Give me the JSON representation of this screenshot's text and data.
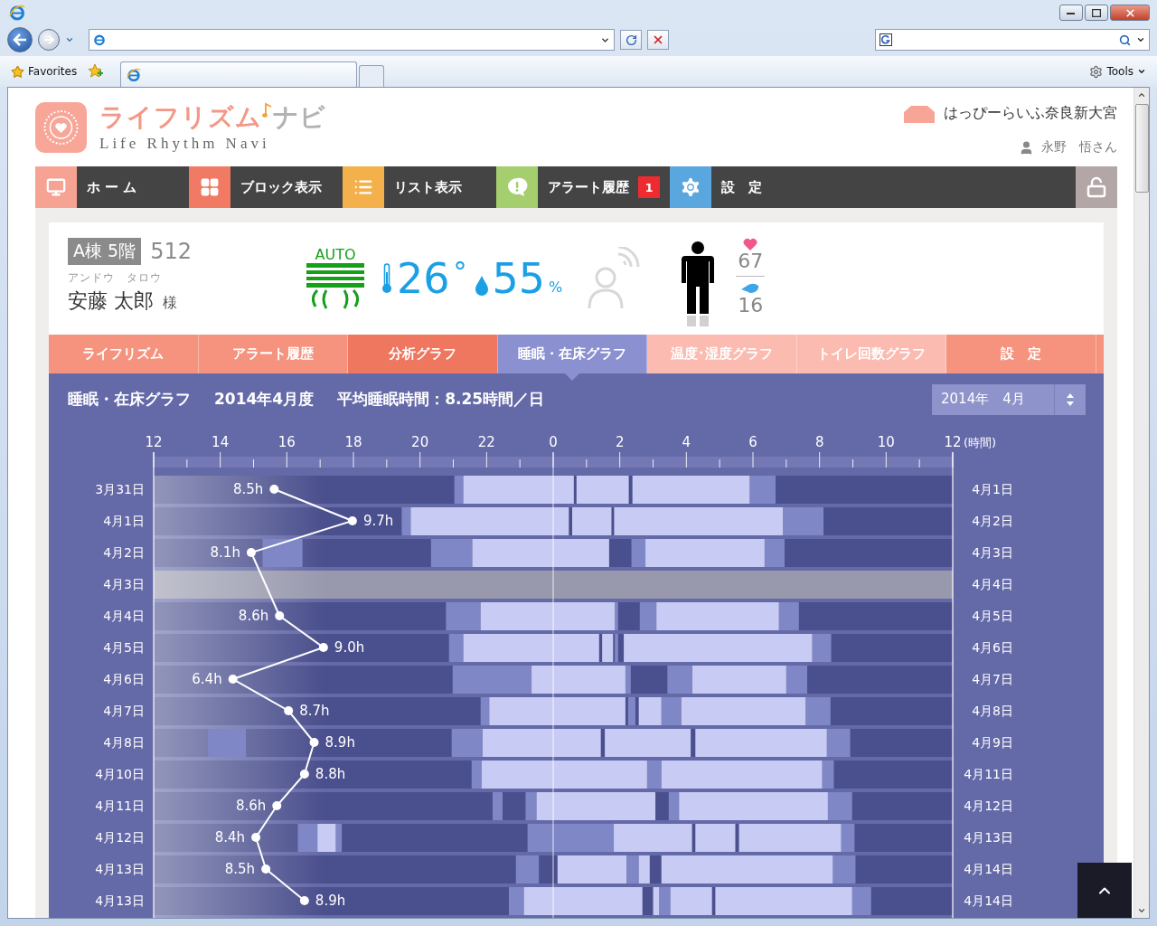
{
  "browser": {
    "favorites": "Favorites",
    "tools": "Tools"
  },
  "header": {
    "logo_main": "ライフリズム",
    "logo_sub": "ナビ",
    "tagline": "Life Rhythm Navi",
    "facility": "はっぴーらいふ奈良新大宮",
    "user": "永野　悟さん"
  },
  "nav": [
    {
      "kind": "home",
      "label": "ホ ー ム",
      "color": "#f7a394"
    },
    {
      "kind": "blocks",
      "label": "ブロック表示",
      "color": "#f07a64"
    },
    {
      "kind": "list",
      "label": "リスト表示",
      "color": "#f4b04a"
    },
    {
      "kind": "alert",
      "label": "アラート履歴",
      "badge": "1",
      "color": "#a5cf6e"
    },
    {
      "kind": "settings",
      "label": "設　定",
      "color": "#5aa7e0"
    }
  ],
  "resident": {
    "building": "A棟 5階",
    "room": "512",
    "kana": "アンドウ　タロウ",
    "name": "安藤 太郎",
    "honorific": "様",
    "aircon_mode": "AUTO",
    "temperature": "26",
    "temperature_unit": "°",
    "humidity": "55",
    "humidity_unit": "%",
    "motion_sensor_active": false,
    "heart_rate": "67",
    "respiration": "16"
  },
  "tabs": [
    {
      "label": "ライフリズム",
      "selected": false,
      "color": "#f5937f"
    },
    {
      "label": "アラート履歴",
      "selected": false,
      "color": "#f5937f"
    },
    {
      "label": "分析グラフ",
      "selected": false,
      "color": "#ef765f"
    },
    {
      "label": "睡眠・在床グラフ",
      "selected": true,
      "color": "#8a90d0"
    },
    {
      "label": "温度･湿度グラフ",
      "selected": false,
      "color": "#fbbbb1"
    },
    {
      "label": "トイレ回数グラフ",
      "selected": false,
      "color": "#fbbbb1"
    },
    {
      "label": "設　定",
      "selected": false,
      "color": "#f5937f"
    }
  ],
  "graph": {
    "title": "睡眠・在床グラフ",
    "period": "2014年4月度",
    "average": "平均睡眠時間：8.25時間／日",
    "month_select": "2014年　4月",
    "axis_labels": [
      "12",
      "14",
      "16",
      "18",
      "20",
      "22",
      "0",
      "2",
      "4",
      "6",
      "8",
      "10",
      "12"
    ],
    "axis_unit": "(時間)",
    "rows": [
      {
        "date": "3月31日",
        "next_date": "4月1日",
        "no_data": false,
        "sleep": "8.5h"
      },
      {
        "date": "4月1日",
        "next_date": "4月2日",
        "no_data": false,
        "sleep": "9.7h"
      },
      {
        "date": "4月2日",
        "next_date": "4月3日",
        "no_data": false,
        "sleep": "8.1h"
      },
      {
        "date": "4月3日",
        "next_date": "4月4日",
        "no_data": true
      },
      {
        "date": "4月4日",
        "next_date": "4月5日",
        "no_data": false,
        "sleep": "8.6h"
      },
      {
        "date": "4月5日",
        "next_date": "4月6日",
        "no_data": false,
        "sleep": "9.0h"
      },
      {
        "date": "4月6日",
        "next_date": "4月7日",
        "no_data": false,
        "sleep": "6.4h"
      },
      {
        "date": "4月7日",
        "next_date": "4月8日",
        "no_data": false,
        "sleep": "8.7h"
      },
      {
        "date": "4月8日",
        "next_date": "4月9日",
        "no_data": false,
        "sleep": "8.9h"
      },
      {
        "date": "4月10日",
        "next_date": "4月11日",
        "no_data": false,
        "sleep": "8.8h"
      },
      {
        "date": "4月11日",
        "next_date": "4月12日",
        "no_data": false,
        "sleep": "8.6h"
      },
      {
        "date": "4月12日",
        "next_date": "4月13日",
        "no_data": false,
        "sleep": "8.4h"
      },
      {
        "date": "4月13日",
        "next_date": "4月14日",
        "no_data": false,
        "sleep": "8.5h"
      },
      {
        "date": "4月13日",
        "next_date": "4月14日",
        "no_data": false,
        "sleep": "8.9h"
      }
    ]
  }
}
